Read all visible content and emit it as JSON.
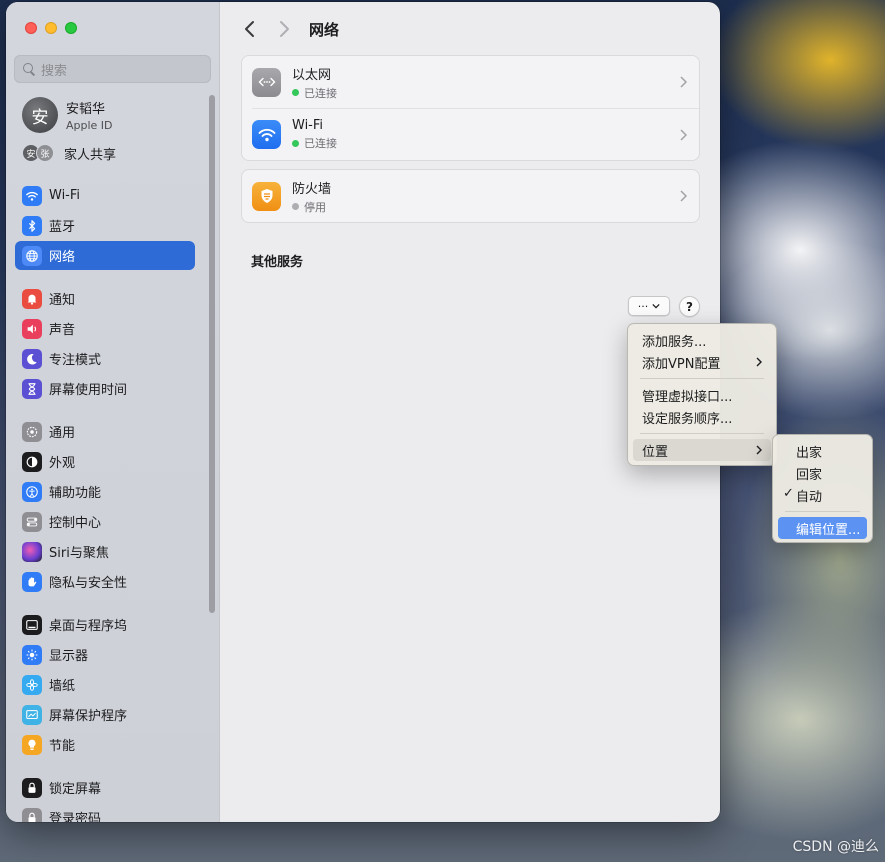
{
  "sidebar": {
    "search_placeholder": "搜索",
    "account": {
      "avatar_text": "安",
      "name": "安韬华",
      "subtitle": "Apple ID"
    },
    "family": {
      "avatar_1": "安",
      "avatar_2": "张",
      "label": "家人共享"
    },
    "items": [
      {
        "label": "Wi-Fi",
        "icon": "wifi-icon",
        "color": "#2f7cf6"
      },
      {
        "label": "蓝牙",
        "icon": "bluetooth-icon",
        "color": "#2f7cf6"
      },
      {
        "label": "网络",
        "icon": "globe-icon",
        "color": "#2f7cf6",
        "active": true
      },
      {
        "label": "通知",
        "icon": "bell-icon",
        "color": "#ea4c3f"
      },
      {
        "label": "声音",
        "icon": "speaker-icon",
        "color": "#ea3f5c"
      },
      {
        "label": "专注模式",
        "icon": "moon-icon",
        "color": "#5b4fd3"
      },
      {
        "label": "屏幕使用时间",
        "icon": "hourglass-icon",
        "color": "#5b4fd3"
      },
      {
        "label": "通用",
        "icon": "gear-icon",
        "color": "#8e8e93"
      },
      {
        "label": "外观",
        "icon": "appearance-icon",
        "color": "#1c1c1e"
      },
      {
        "label": "辅助功能",
        "icon": "accessibility-icon",
        "color": "#2f7cf6"
      },
      {
        "label": "控制中心",
        "icon": "toggles-icon",
        "color": "#8e8e93"
      },
      {
        "label": "Siri与聚焦",
        "icon": "siri-icon",
        "color": "#6a3fd1"
      },
      {
        "label": "隐私与安全性",
        "icon": "hand-icon",
        "color": "#2f7cf6"
      },
      {
        "label": "桌面与程序坞",
        "icon": "dock-icon",
        "color": "#1c1c1e"
      },
      {
        "label": "显示器",
        "icon": "sun-icon",
        "color": "#2f7cf6"
      },
      {
        "label": "墙纸",
        "icon": "flower-icon",
        "color": "#35aaf0"
      },
      {
        "label": "屏幕保护程序",
        "icon": "screensaver-icon",
        "color": "#3fb2e6"
      },
      {
        "label": "节能",
        "icon": "bulb-icon",
        "color": "#f5a623"
      },
      {
        "label": "锁定屏幕",
        "icon": "lock-icon",
        "color": "#1c1c1e"
      },
      {
        "label": "登录密码",
        "icon": "lock-icon",
        "color": "#8e8e93"
      }
    ]
  },
  "main": {
    "title": "网络",
    "services": [
      {
        "name": "以太网",
        "status": "已连接",
        "status_color": "#34c759",
        "icon": "ethernet-icon"
      },
      {
        "name": "Wi-Fi",
        "status": "已连接",
        "status_color": "#34c759",
        "icon": "wifi-icon"
      },
      {
        "name": "防火墙",
        "status": "停用",
        "status_color": "#aeaeb2",
        "icon": "firewall-icon"
      }
    ],
    "other_services_heading": "其他服务",
    "more_button": "···",
    "help_button": "?"
  },
  "menu": {
    "items": [
      {
        "label": "添加服务..."
      },
      {
        "label": "添加VPN配置",
        "submenu": true
      },
      {
        "label": "管理虚拟接口..."
      },
      {
        "label": "设定服务顺序..."
      },
      {
        "label": "位置",
        "submenu": true,
        "highlighted": true
      }
    ],
    "location_submenu": [
      {
        "label": "出家"
      },
      {
        "label": "回家"
      },
      {
        "label": "自动",
        "checked": true,
        "check_mark": "✓"
      },
      {
        "label": "编辑位置...",
        "selected": true
      }
    ]
  },
  "watermark": "CSDN @迪么"
}
